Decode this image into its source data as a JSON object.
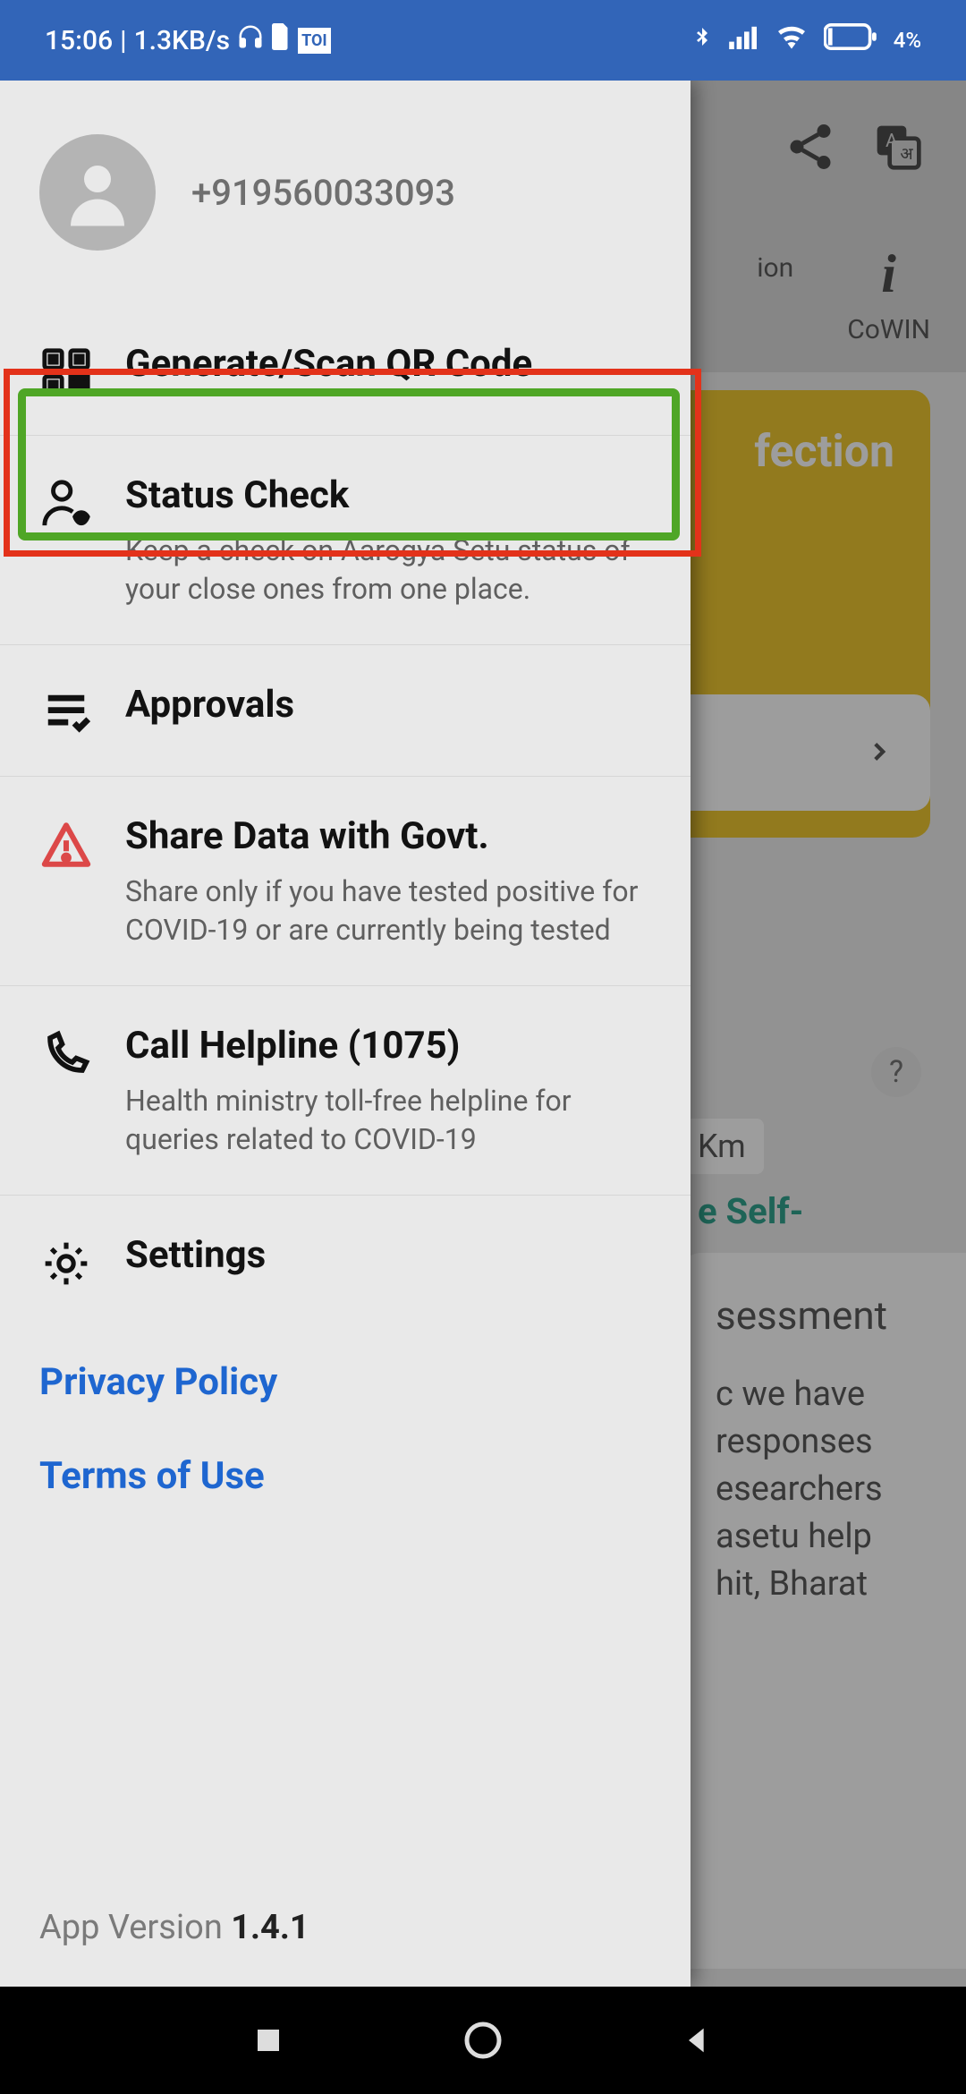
{
  "status_bar": {
    "time": "15:06",
    "speed": "1.3KB/s",
    "battery": "4%"
  },
  "background": {
    "tab_ion": "ion",
    "tab_cowin": "CoWIN",
    "yellow_title": "fection",
    "km_badge": "Km",
    "help_char": "?",
    "self_text": "e Self-",
    "bottom_title": "sessment",
    "bottom_body": "c we have\nresponses\nesearchers\nasetu help\nhit, Bharat"
  },
  "drawer": {
    "phone": "+919560033093",
    "items": [
      {
        "icon": "qr",
        "title": "Generate/Scan QR Code",
        "desc": ""
      },
      {
        "icon": "status",
        "title": "Status Check",
        "desc": "Keep a check on Aarogya Setu status of your close ones from one place."
      },
      {
        "icon": "approvals",
        "title": "Approvals",
        "desc": ""
      },
      {
        "icon": "warn",
        "title": "Share Data with Govt.",
        "desc": "Share only if you have tested positive for COVID-19 or are currently being tested"
      },
      {
        "icon": "phone",
        "title": "Call Helpline (1075)",
        "desc": "Health ministry toll-free helpline for queries related to COVID-19"
      },
      {
        "icon": "settings",
        "title": "Settings",
        "desc": ""
      }
    ],
    "links": {
      "privacy": "Privacy Policy",
      "terms": "Terms of Use"
    },
    "version_label": "App Version ",
    "version": "1.4.1"
  }
}
